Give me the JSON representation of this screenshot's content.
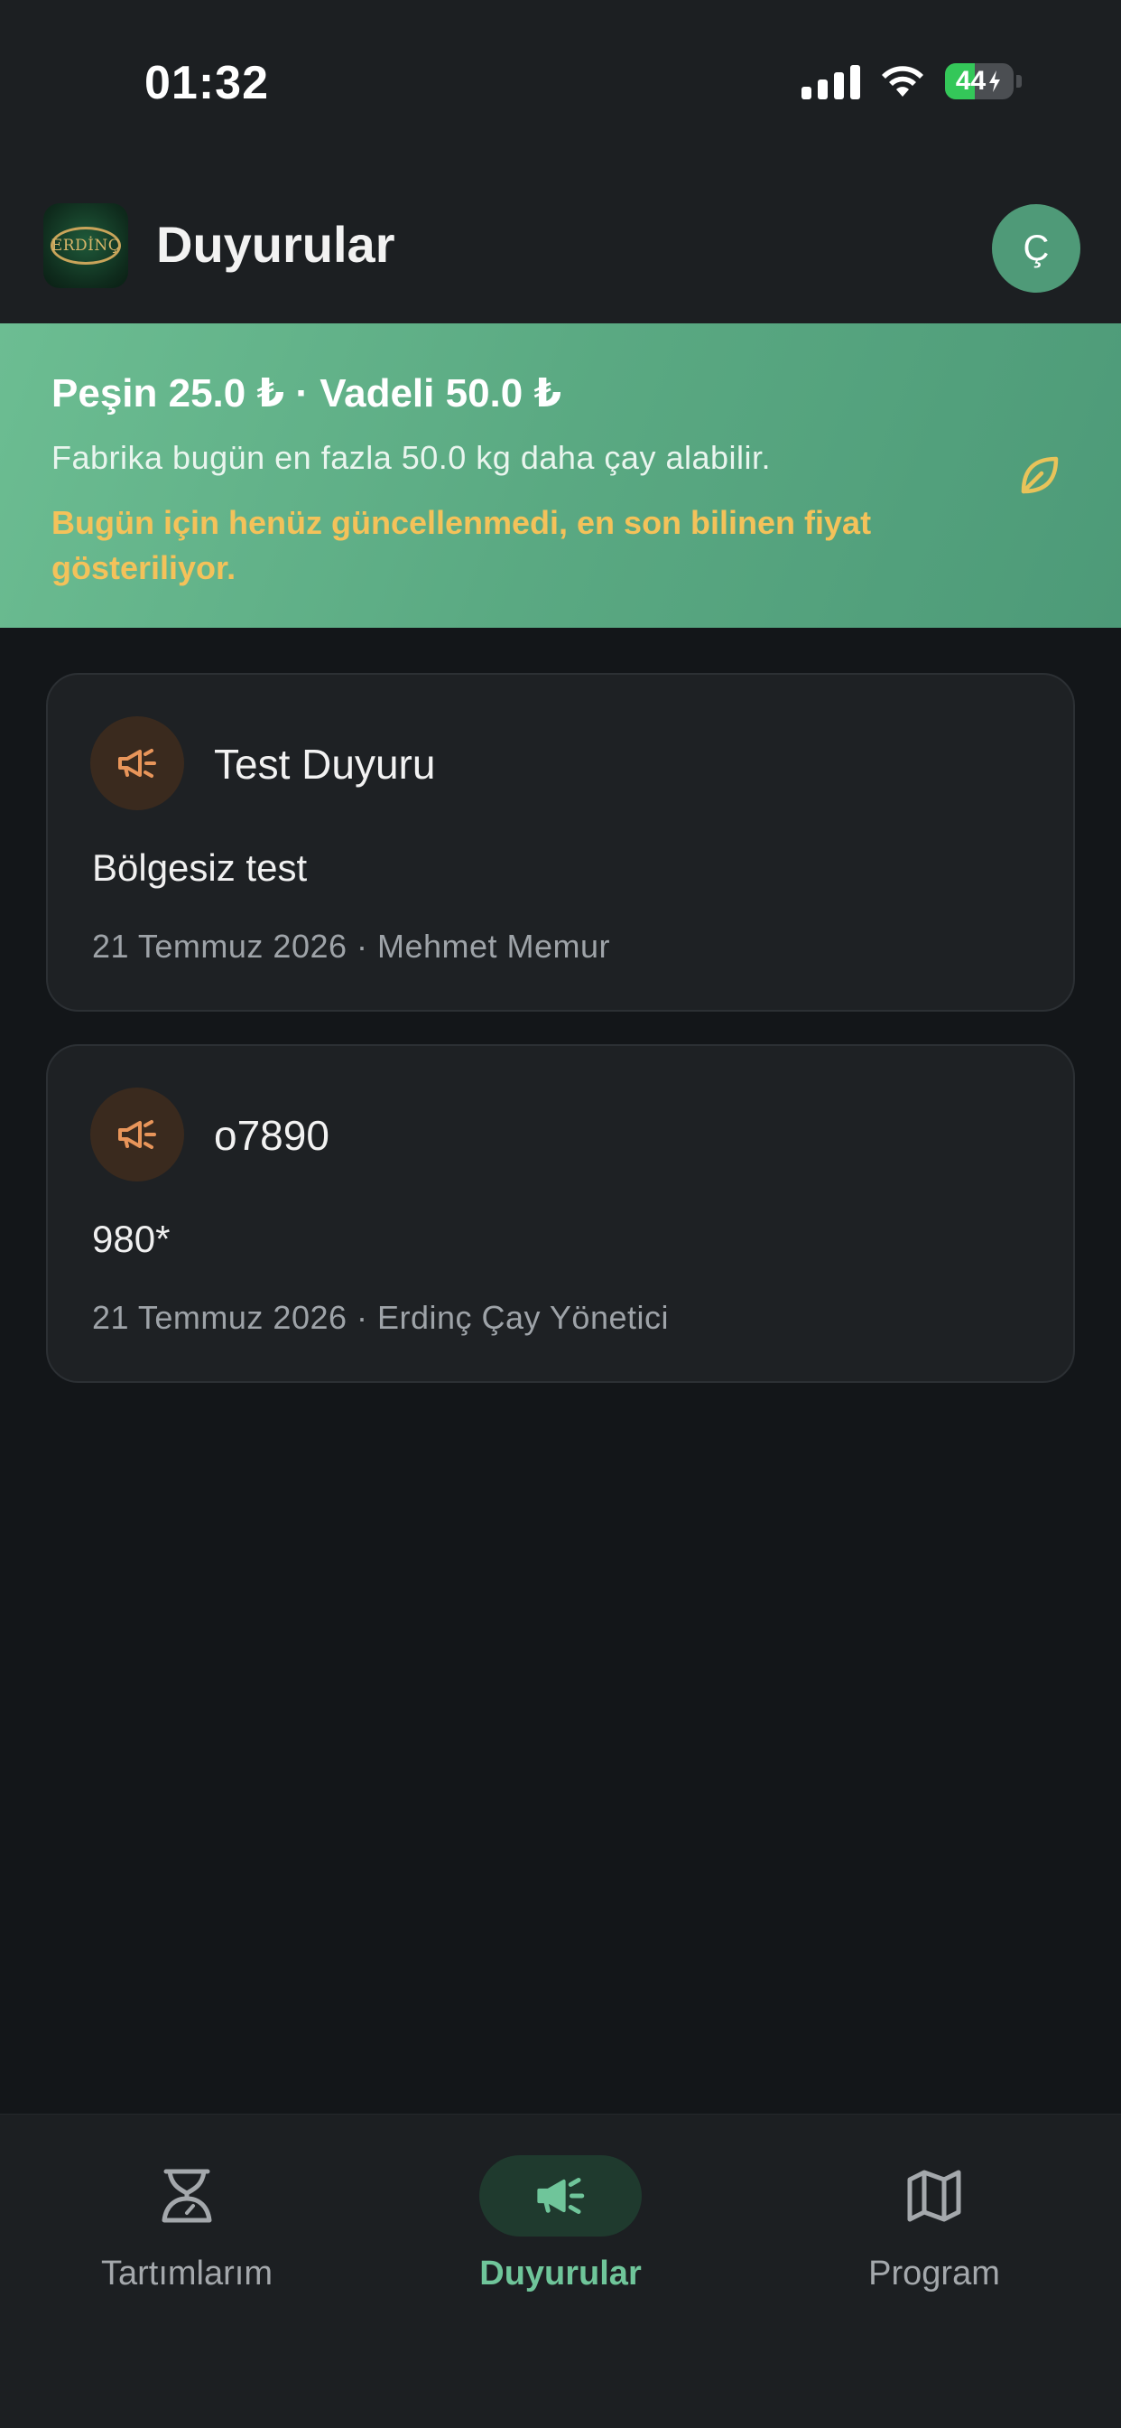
{
  "status_bar": {
    "time": "01:32",
    "battery": "44",
    "battery_level": 0.44
  },
  "header": {
    "title": "Duyurular",
    "logo_text": "ERDİNÇ",
    "avatar_initial": "Ç"
  },
  "price_banner": {
    "title": "Peşin 25.0 ₺ · Vadeli 50.0 ₺",
    "capacity": "Fabrika bugün en fazla 50.0 kg daha çay alabilir.",
    "warning": "Bugün için henüz güncellenmedi, en son bilinen fiyat gösteriliyor.",
    "icon": "leaf-icon"
  },
  "announcements": [
    {
      "icon": "megaphone-icon",
      "title": "Test Duyuru",
      "body": "Bölgesiz test",
      "meta": "21 Temmuz 2026 · Mehmet Memur"
    },
    {
      "icon": "megaphone-icon",
      "title": "o7890",
      "body": "980*",
      "meta": "21 Temmuz 2026 · Erdinç Çay Yönetici"
    }
  ],
  "bottom_nav": {
    "items": [
      {
        "label": "Tartımlarım",
        "icon": "scale-icon",
        "active": false
      },
      {
        "label": "Duyurular",
        "icon": "megaphone-icon",
        "active": true
      },
      {
        "label": "Program",
        "icon": "map-icon",
        "active": false
      }
    ]
  },
  "colors": {
    "accent": "#6fc59a",
    "banner": "#5aa982",
    "warning": "#f4c25a",
    "icon_orange": "#e8955a",
    "background": "#131619",
    "card": "#1e2124"
  }
}
